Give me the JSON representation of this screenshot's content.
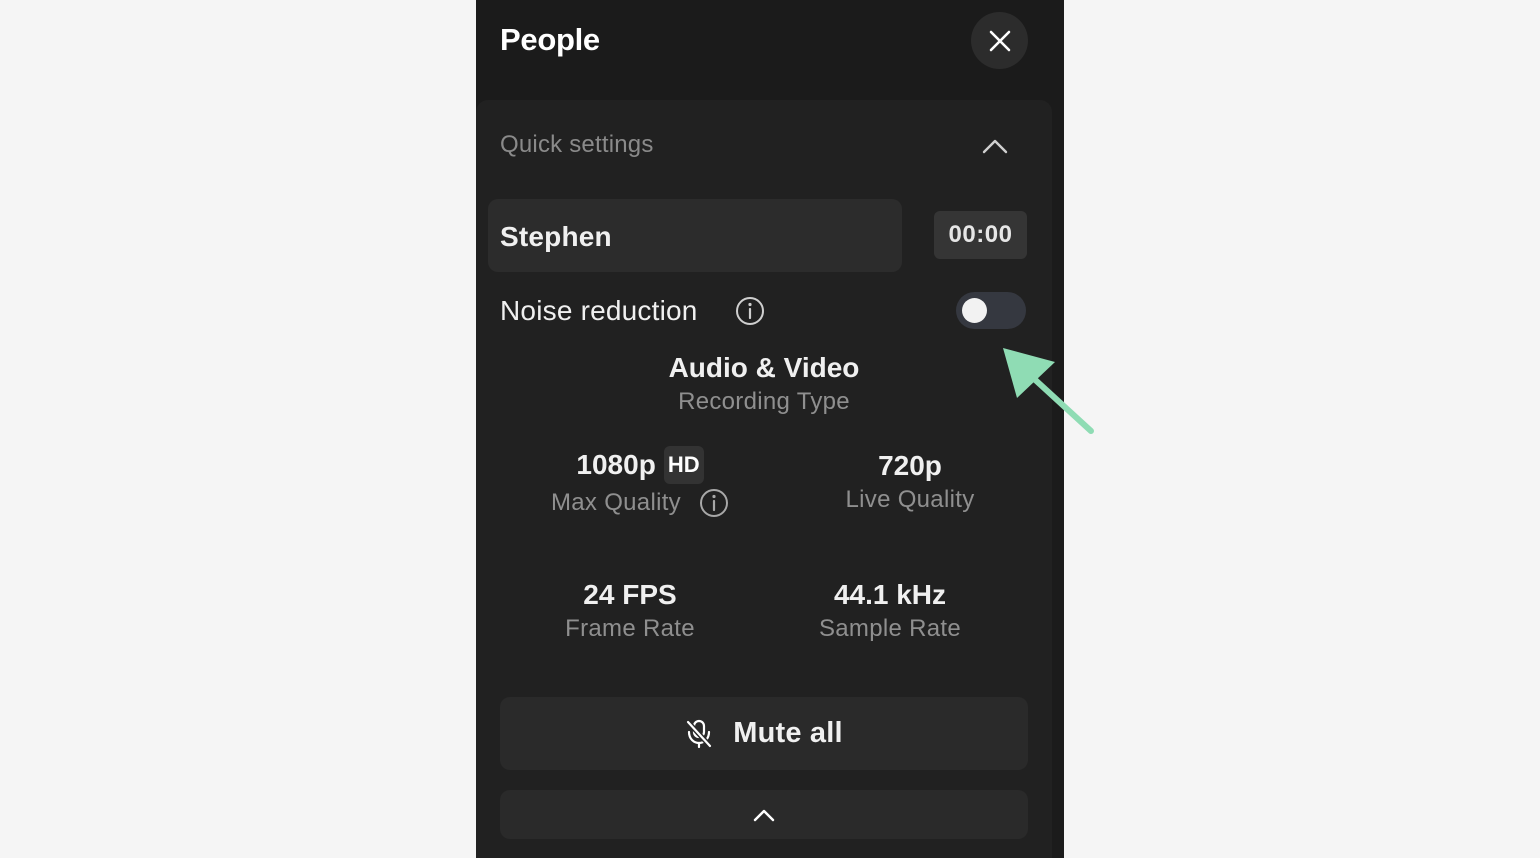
{
  "panel": {
    "title": "People",
    "close_icon": "close-icon"
  },
  "quick_settings": {
    "label": "Quick settings",
    "collapse_icon": "chevron-up-icon",
    "participant_name": "Stephen",
    "timer": "00:00",
    "noise_reduction": {
      "label": "Noise reduction",
      "info_icon": "info-icon",
      "enabled": false
    },
    "recording_type": {
      "value": "Audio & Video",
      "label": "Recording Type"
    },
    "max_quality": {
      "value": "1080p",
      "badge": "HD",
      "label": "Max Quality",
      "info_icon": "info-icon"
    },
    "live_quality": {
      "value": "720p",
      "label": "Live Quality"
    },
    "frame_rate": {
      "value": "24 FPS",
      "label": "Frame Rate"
    },
    "sample_rate": {
      "value": "44.1 kHz",
      "label": "Sample Rate"
    },
    "mute_all": {
      "label": "Mute all",
      "icon": "mic-off-icon"
    },
    "expand_icon": "chevron-up-icon"
  },
  "colors": {
    "panel_bg": "#1b1b1b",
    "card_bg": "#212121",
    "page_bg": "#f5f5f5",
    "annotation_arrow": "#8fdcb4"
  }
}
